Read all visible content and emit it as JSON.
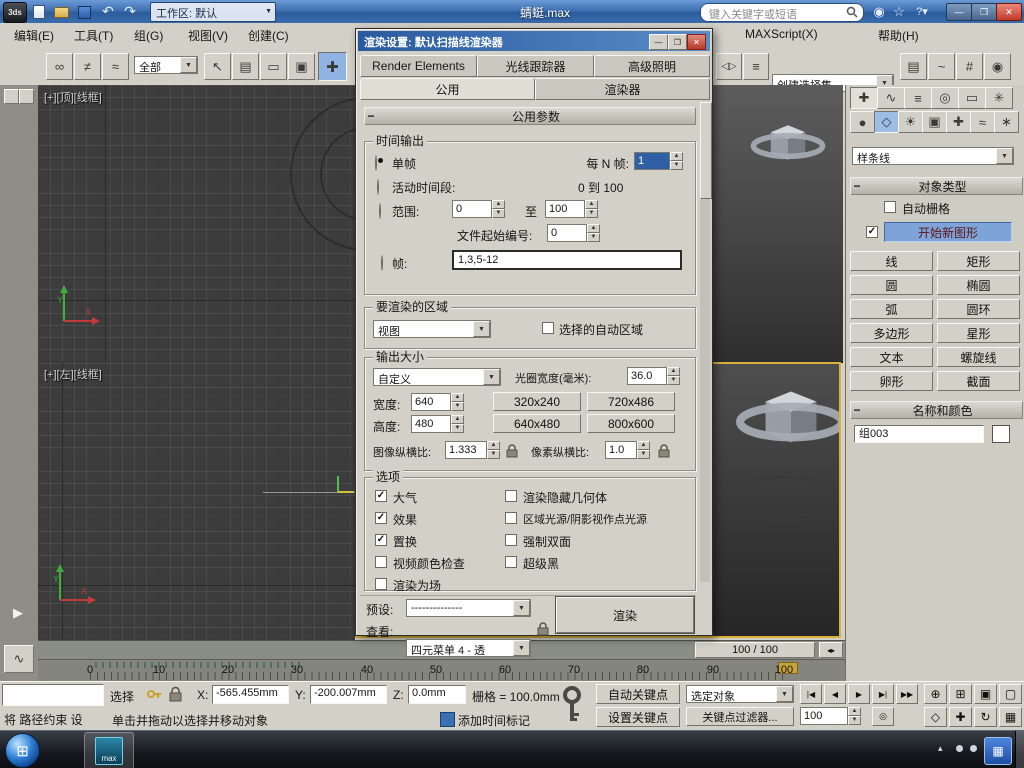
{
  "titlebar": {
    "app_label": "3ds",
    "workspace": "工作区: 默认",
    "title": "蜻蜓.max",
    "search_placeholder": "键入关键字或短语"
  },
  "menubar": {
    "left": [
      "编辑(E)",
      "工具(T)",
      "组(G)",
      "视图(V)",
      "创建(C)"
    ],
    "right": [
      "MAXScript(X)",
      "帮助(H)"
    ]
  },
  "toolbar": {
    "selection_filter": "全部",
    "named_sets": "创建选择集"
  },
  "viewports": {
    "top_label": "[+][顶][线框]",
    "left_label": "[+][左][线框]"
  },
  "dialog": {
    "title": "渲染设置: 默认扫描线渲染器",
    "tabs_top": [
      "Render Elements",
      "光线跟踪器",
      "高级照明"
    ],
    "tab_common": "公用",
    "tab_renderer": "渲染器",
    "rollout_common": "公用参数",
    "time_output": {
      "group": "时间输出",
      "single": {
        "label": "单帧",
        "checked": true
      },
      "every_nth_label": "每 N 帧:",
      "every_nth_value": "1",
      "active": {
        "label": "活动时间段:",
        "checked": false
      },
      "active_range": "0 到 100",
      "range": {
        "label": "范围:",
        "checked": false
      },
      "range_from": "0",
      "range_to_label": "至",
      "range_to": "100",
      "file_start_label": "文件起始编号:",
      "file_start_value": "0",
      "frames": {
        "label": "帧:",
        "checked": false
      },
      "frames_value": "1,3,5-12"
    },
    "area": {
      "group": "要渲染的区域",
      "view": "视图",
      "auto_region": {
        "label": "选择的自动区域",
        "checked": false
      }
    },
    "output": {
      "group": "输出大小",
      "preset": "自定义",
      "aperture_label": "光圈宽度(毫米):",
      "aperture_value": "36.0",
      "width_label": "宽度:",
      "width_value": "640",
      "height_label": "高度:",
      "height_value": "480",
      "res": [
        "320x240",
        "720x486",
        "640x480",
        "800x600"
      ],
      "image_aspect_label": "图像纵横比:",
      "image_aspect_value": "1.333",
      "pixel_aspect_label": "像素纵横比:",
      "pixel_aspect_value": "1.0"
    },
    "options": {
      "group": "选项",
      "items": [
        {
          "label": "大气",
          "checked": true
        },
        {
          "label": "渲染隐藏几何体",
          "checked": false
        },
        {
          "label": "效果",
          "checked": true
        },
        {
          "label": "区域光源/阴影视作点光源",
          "checked": false
        },
        {
          "label": "置换",
          "checked": true
        },
        {
          "label": "强制双面",
          "checked": false
        },
        {
          "label": "视频颜色检查",
          "checked": false
        },
        {
          "label": "超级黑",
          "checked": false
        },
        {
          "label": "渲染为场",
          "checked": false
        }
      ]
    },
    "footer": {
      "preset_label": "预设:",
      "preset_value": "--------------",
      "view_label": "查看:",
      "view_value": "四元菜单 4 - 透",
      "render": "渲染"
    }
  },
  "panel": {
    "category": "样条线",
    "object_type": {
      "title": "对象类型",
      "autogrid": {
        "label": "自动栅格",
        "checked": false
      },
      "start_new": {
        "label": "开始新图形",
        "checked": true
      },
      "buttons": [
        "线",
        "矩形",
        "圆",
        "椭圆",
        "弧",
        "圆环",
        "多边形",
        "星形",
        "文本",
        "螺旋线",
        "卵形",
        "截面"
      ]
    },
    "name_color": {
      "title": "名称和颜色",
      "name": "组003"
    }
  },
  "timeline": {
    "slider": "100 / 100",
    "ticks": [
      "0",
      "10",
      "20",
      "30",
      "40",
      "50",
      "60",
      "70",
      "80",
      "90",
      "100"
    ]
  },
  "status": {
    "selection": "选择",
    "x_label": "X:",
    "x": "-565.455mm",
    "y_label": "Y:",
    "y": "-200.007mm",
    "z_label": "Z:",
    "z": "0.0mm",
    "grid": "栅格 = 100.0mm",
    "script": "将 路径约束 设",
    "prompt": "单击并拖动以选择并移动对象",
    "time_tag": "添加时间标记",
    "auto_key": "自动关键点",
    "set_key": "设置关键点",
    "selected": "选定对象",
    "key_filters": "关键点过滤器...",
    "frame": "100"
  },
  "taskbar": {
    "app_label": "max"
  },
  "colors": {
    "active_viewport_border": "#d9b03c",
    "titlebar_blue": "#3f6fb5",
    "start_new_shape_bg": "#7da3d8"
  }
}
